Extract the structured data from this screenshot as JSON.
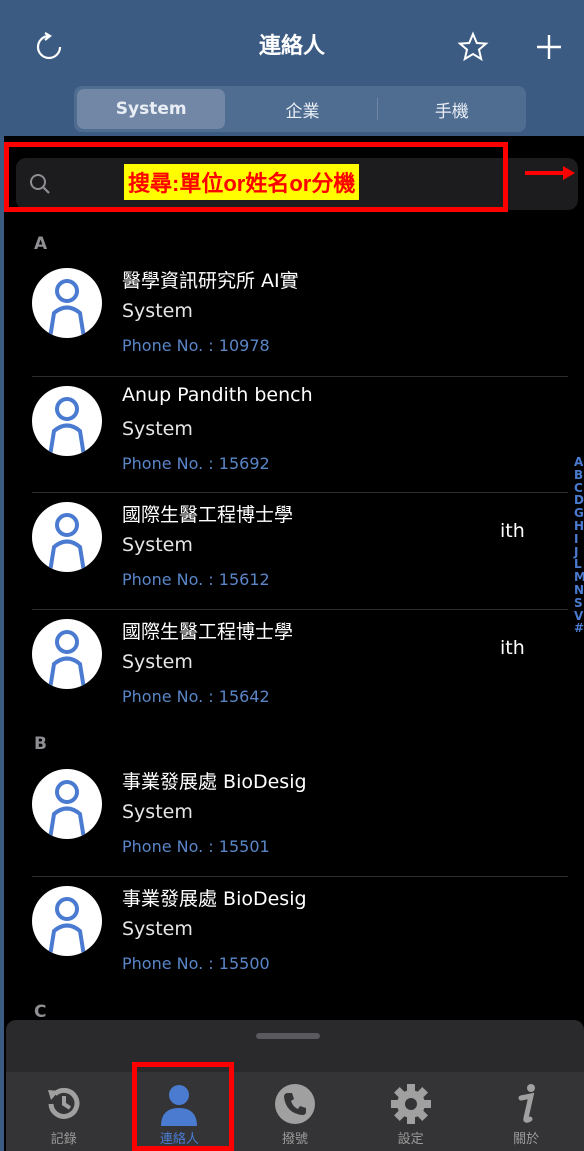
{
  "header": {
    "title": "連絡人"
  },
  "segments": [
    {
      "label": "System",
      "active": true
    },
    {
      "label": "企業",
      "active": false
    },
    {
      "label": "手機",
      "active": false
    }
  ],
  "search": {
    "annotation": "搜尋:單位or姓名or分機"
  },
  "sections": [
    {
      "letter": "A",
      "contacts": [
        {
          "name": "醫學資訊研究所 AI實",
          "name_tail": "",
          "org": "System",
          "phone": "Phone No. : 10978"
        },
        {
          "name": "Anup Pandith bench",
          "name_tail": "",
          "org": "System",
          "phone": "Phone No. : 15692"
        },
        {
          "name": "國際生醫工程博士學",
          "name_tail": "ith",
          "org": "System",
          "phone": "Phone No. : 15612"
        },
        {
          "name": "國際生醫工程博士學",
          "name_tail": "ith",
          "org": "System",
          "phone": "Phone No. : 15642"
        }
      ]
    },
    {
      "letter": "B",
      "contacts": [
        {
          "name": "事業發展處 BioDesig",
          "name_tail": "",
          "org": "System",
          "phone": "Phone No. : 15501"
        },
        {
          "name": "事業發展處 BioDesig",
          "name_tail": "",
          "org": "System",
          "phone": "Phone No. : 15500"
        }
      ]
    },
    {
      "letter": "C",
      "contacts": []
    }
  ],
  "index": [
    "A",
    "B",
    "C",
    "D",
    "G",
    "H",
    "I",
    "J",
    "L",
    "M",
    "N",
    "S",
    "V",
    "#"
  ],
  "tabs": [
    {
      "label": "記錄",
      "icon": "history-icon",
      "active": false
    },
    {
      "label": "連絡人",
      "icon": "contacts-icon",
      "active": true
    },
    {
      "label": "撥號",
      "icon": "phone-icon",
      "active": false
    },
    {
      "label": "設定",
      "icon": "gear-icon",
      "active": false
    },
    {
      "label": "關於",
      "icon": "info-icon",
      "active": false
    }
  ],
  "colors": {
    "header": "#3c5b82",
    "accent": "#4a7bd0",
    "annotation": "#ff0000",
    "highlight": "#fffd00"
  }
}
